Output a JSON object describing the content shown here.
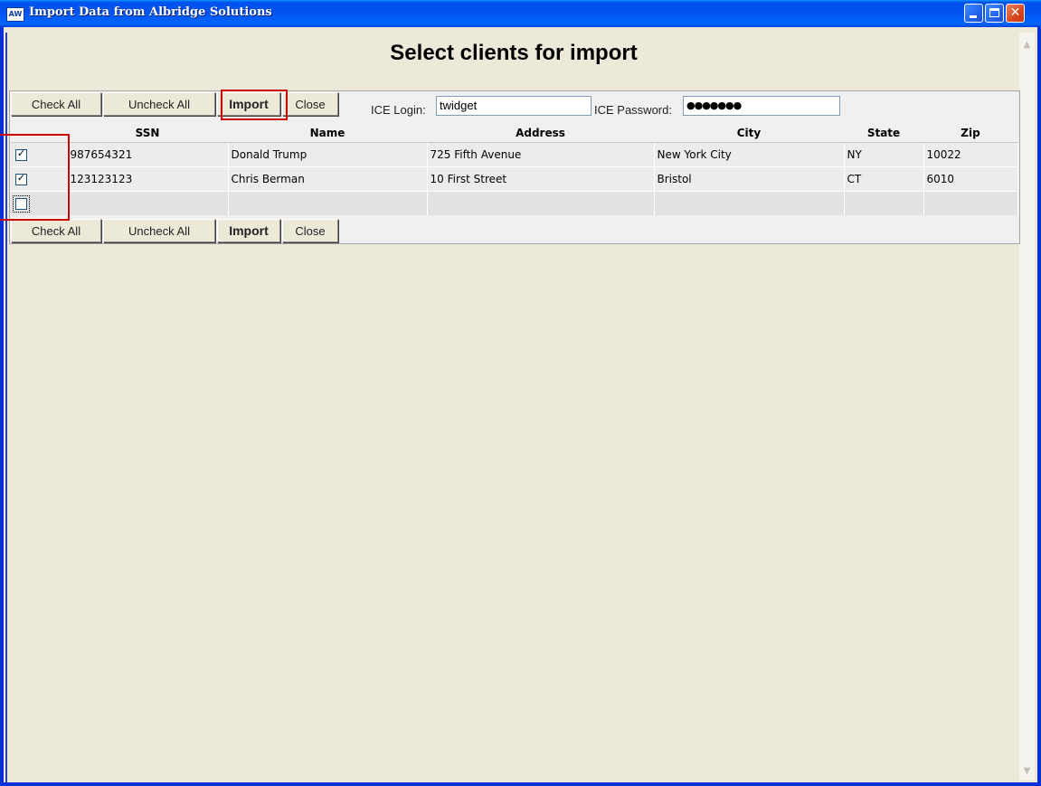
{
  "window": {
    "icon_text": "AW",
    "title": "Import Data from Albridge Solutions",
    "minimize_glyph": "",
    "maximize_glyph": "",
    "close_glyph": "✕"
  },
  "page": {
    "heading": "Select clients for import"
  },
  "toolbar": {
    "check_all": "Check All",
    "uncheck_all": "Uncheck All",
    "import": "Import",
    "close": "Close"
  },
  "credentials": {
    "login_label": "ICE Login:",
    "login_value": "twidget",
    "password_label": "ICE Password:",
    "password_value": "●●●●●●●"
  },
  "table": {
    "columns": [
      "",
      "SSN",
      "Name",
      "Address",
      "City",
      "State",
      "Zip"
    ],
    "rows": [
      {
        "checked": true,
        "ssn": "987654321",
        "name": "Donald Trump",
        "address": "725 Fifth Avenue",
        "city": "New York City",
        "state": "NY",
        "zip": "10022"
      },
      {
        "checked": true,
        "ssn": "123123123",
        "name": "Chris Berman",
        "address": "10 First Street",
        "city": "Bristol",
        "state": "CT",
        "zip": "6010"
      },
      {
        "checked": false,
        "ssn": "",
        "name": "",
        "address": "",
        "city": "",
        "state": "",
        "zip": ""
      }
    ]
  },
  "checkmark_glyph": "✓",
  "colors": {
    "titlebar": "#0053ee",
    "client_bg": "#ece9d8",
    "highlight": "#cc0000"
  }
}
